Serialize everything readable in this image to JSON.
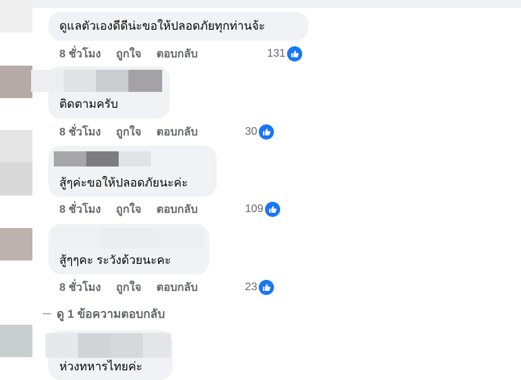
{
  "comments": [
    {
      "text": "ดูแลตัวเองดีดีน่ะขอให้ปลอดภัยทุกท่านจ้ะ",
      "time": "8 ชั่วโมง",
      "like_label": "ถูกใจ",
      "reply_label": "ตอบกลับ",
      "reactions": "131"
    },
    {
      "text": "ติดตามครับ",
      "time": "8 ชั่วโมง",
      "like_label": "ถูกใจ",
      "reply_label": "ตอบกลับ",
      "reactions": "30"
    },
    {
      "text": "สู้ๆค่ะขอให้ปลอดภัยนะค่ะ",
      "time": "8 ชั่วโมง",
      "like_label": "ถูกใจ",
      "reply_label": "ตอบกลับ",
      "reactions": "109"
    },
    {
      "text": "สู้ๆๆคะ ระวังด้วยนะคะ",
      "time": "8 ชั่วโมง",
      "like_label": "ถูกใจ",
      "reply_label": "ตอบกลับ",
      "reactions": "23"
    },
    {
      "text": "ห่วงทหารไทยค่ะ"
    }
  ],
  "view_replies": "ดู 1 ข้อความตอบกลับ",
  "icons": {
    "reaction": "like-thumb-icon"
  },
  "colors": {
    "accent": "#1877f2",
    "bubble": "#f0f2f5",
    "meta": "#65676b"
  }
}
